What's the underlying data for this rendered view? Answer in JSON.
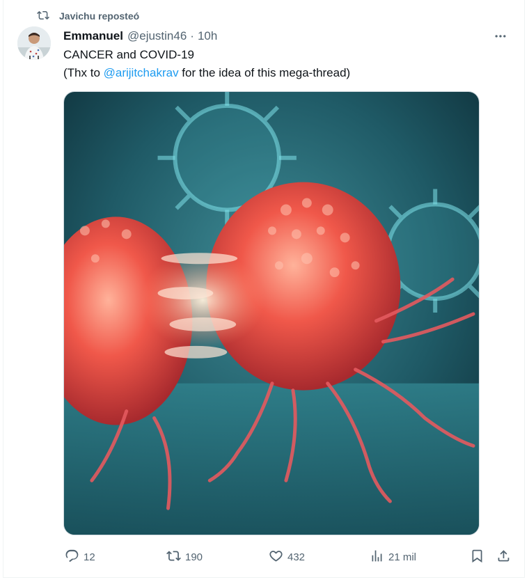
{
  "repost": {
    "text": "Javichu reposteó"
  },
  "author": {
    "name": "Emmanuel",
    "handle": "@ejustin46",
    "separator": "·",
    "time": "10h"
  },
  "tweet": {
    "line1": "CANCER and COVID-19",
    "line2_prefix": "(Thx to ",
    "mention": "@arijitchakrav",
    "line2_suffix": " for the idea of this mega-thread)"
  },
  "media": {
    "alt": "Image"
  },
  "actions": {
    "replies": "12",
    "reposts": "190",
    "likes": "432",
    "views": "21 mil"
  },
  "icons": {
    "repost": "repost-icon",
    "more": "more-icon",
    "reply": "reply-icon",
    "like": "heart-icon",
    "views": "views-icon",
    "bookmark": "bookmark-icon",
    "share": "share-icon"
  },
  "colors": {
    "accent": "#1d9bf0",
    "muted": "#536471",
    "text": "#0f1419"
  }
}
